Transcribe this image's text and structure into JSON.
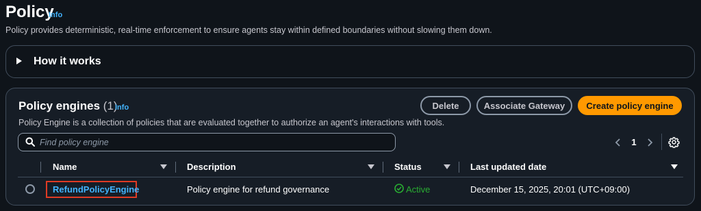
{
  "header": {
    "title": "Policy",
    "info_label": "Info",
    "description": "Policy provides deterministic, real-time enforcement to ensure agents stay within defined boundaries without slowing them down."
  },
  "how_it_works": {
    "label": "How it works"
  },
  "engines": {
    "title": "Policy engines",
    "count": "(1)",
    "info_label": "Info",
    "description": "Policy Engine is a collection of policies that are evaluated together to authorize an agent's interactions with tools.",
    "buttons": {
      "delete": "Delete",
      "associate": "Associate Gateway",
      "create": "Create policy engine"
    },
    "search": {
      "placeholder": "Find policy engine",
      "value": ""
    },
    "pagination": {
      "current_page": "1"
    },
    "columns": [
      "Name",
      "Description",
      "Status",
      "Last updated date"
    ],
    "rows": [
      {
        "name": "RefundPolicyEngine",
        "description": "Policy engine for refund governance",
        "status": "Active",
        "last_updated": "December 15, 2025, 20:01 (UTC+09:00)"
      }
    ]
  },
  "colors": {
    "background": "#0f141a",
    "panel": "#161d26",
    "accent": "#ff9900",
    "link": "#42b4ff",
    "success": "#29ad32",
    "highlight": "#e03b24"
  },
  "icons": {
    "expand": "caret-right-icon",
    "search": "search-icon",
    "prev": "chevron-left-icon",
    "next": "chevron-right-icon",
    "settings": "gear-icon",
    "status": "check-circle-icon",
    "sort": "caret-down-icon"
  }
}
